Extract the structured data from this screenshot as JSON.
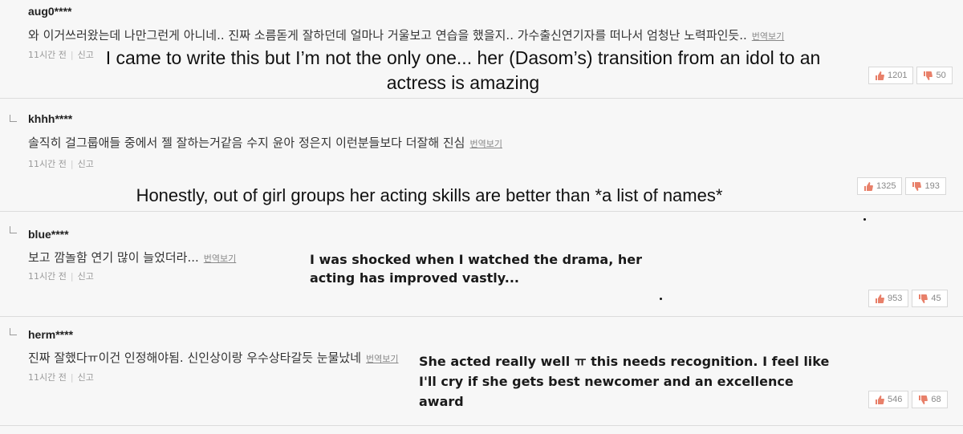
{
  "comments": [
    {
      "user": "aug0****",
      "text": "와 이거쓰러왔는데 나만그런게 아니네.. 진짜 소름돋게 잘하던데 얼마나 거울보고 연습을 했을지.. 가수출신연기자를 떠나서 엄청난 노력파인듯..",
      "translate": "번역보기",
      "time": "11시간 전",
      "report": "신고",
      "likes": "1201",
      "dislikes": "50",
      "overlay": "I came to write this but I’m not the only one... her (Dasom’s) transition from an idol to an actress is amazing"
    },
    {
      "user": "khhh****",
      "text": "솔직히 걸그룹애들 중에서 젤 잘하는거같음 수지 윤아 정은지 이런분들보다 더잘해 진심",
      "translate": "번역보기",
      "time": "11시간 전",
      "report": "신고",
      "likes": "1325",
      "dislikes": "193",
      "overlay": "Honestly, out of girl groups her acting skills are better than *a list of names*"
    },
    {
      "user": "blue****",
      "text": "보고 깜놀함 연기 많이 늘었더라...",
      "translate": "번역보기",
      "time": "11시간 전",
      "report": "신고",
      "likes": "953",
      "dislikes": "45",
      "overlay": "I was shocked when I watched the drama, her acting has improved vastly..."
    },
    {
      "user": "herm****",
      "text": "진짜 잘했다ㅠ이건 인정해야됨. 신인상이랑 우수상타갈듯 눈물났네",
      "translate": "번역보기",
      "time": "11시간 전",
      "report": "신고",
      "likes": "546",
      "dislikes": "68",
      "overlay": "She acted really well ㅠ this needs recognition. I feel like I'll cry if she gets best newcomer and an excellence award"
    }
  ],
  "icons": {
    "like": "thumbs-up-icon",
    "dislike": "thumbs-down-icon",
    "reply": "reply-corner-icon"
  },
  "colors": {
    "background": "#f7f7f7",
    "divider": "#dcdcdc",
    "like": "#e8806a",
    "dislike": "#e8806a"
  }
}
